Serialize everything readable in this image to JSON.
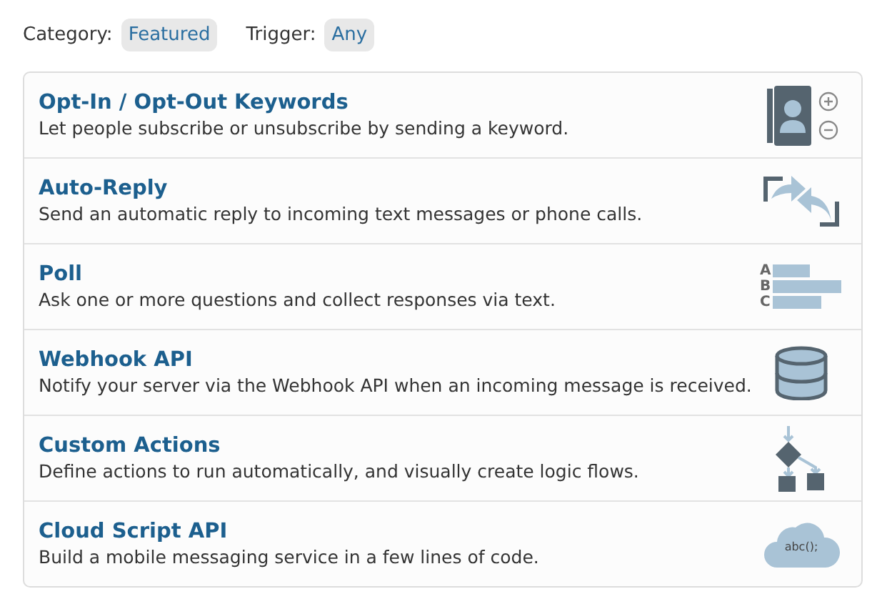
{
  "filters": [
    {
      "label": "Category:",
      "value": "Featured"
    },
    {
      "label": "Trigger:",
      "value": "Any"
    }
  ],
  "services": [
    {
      "title": "Opt-In / Opt-Out Keywords",
      "description": "Let people subscribe or unsubscribe by sending a keyword.",
      "kind": "contacts"
    },
    {
      "title": "Auto-Reply",
      "description": "Send an automatic reply to incoming text messages or phone calls.",
      "kind": "reply"
    },
    {
      "title": "Poll",
      "description": "Ask one or more questions and collect responses via text.",
      "kind": "poll",
      "icon_letters": [
        "A",
        "B",
        "C"
      ]
    },
    {
      "title": "Webhook API",
      "description": "Notify your server via the Webhook API when an incoming message is received.",
      "kind": "database"
    },
    {
      "title": "Custom Actions",
      "description": "Define actions to run automatically, and visually create logic flows.",
      "kind": "flow"
    },
    {
      "title": "Cloud Script API",
      "description": "Build a mobile messaging service in a few lines of code.",
      "kind": "cloud",
      "icon_text": "abc();"
    }
  ]
}
